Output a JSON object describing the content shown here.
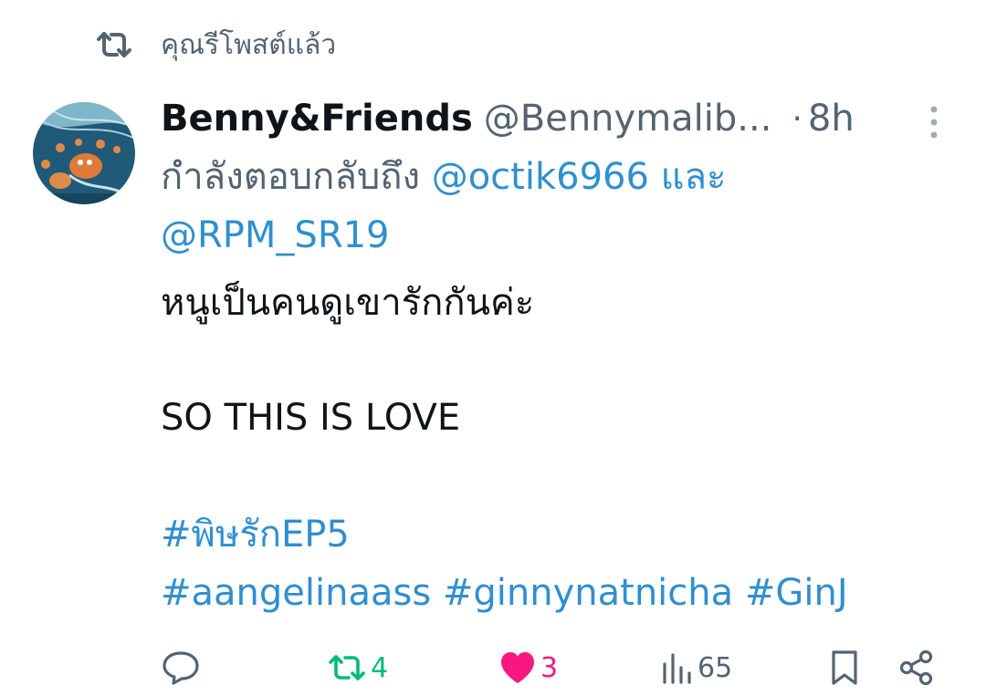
{
  "repost_indicator": {
    "icon": "repost-icon",
    "text": "คุณรีโพสต์แล้ว"
  },
  "tweet": {
    "avatar": "avatar-image",
    "display_name": "Benny&Friends",
    "handle": "@Bennymalib...",
    "separator": "·",
    "time": "8h",
    "reply_prefix": "กำลังตอบกลับถึง",
    "reply_to_1": "@octik6966",
    "reply_joiner": "และ",
    "reply_to_2": "@RPM_SR19",
    "text_line_1": "หนูเป็นคนดูเขารักกันค่ะ",
    "text_line_2": "SO THIS IS LOVE",
    "hashtag_1": "#พิษรักEP5",
    "hashtag_2": "#aangelinaass",
    "hashtag_3": "#ginnynatnicha",
    "hashtag_4": "#GinJ"
  },
  "actions": {
    "reply_icon": "reply-icon",
    "repost_icon": "repost-icon",
    "repost_count": "4",
    "like_icon": "heart-icon",
    "like_count": "3",
    "views_icon": "views-icon",
    "views_count": "65",
    "bookmark_icon": "bookmark-icon",
    "share_icon": "share-icon"
  },
  "colors": {
    "text": "#0f1419",
    "secondary": "#536471",
    "link": "#2f8fd0",
    "repost_active": "#00ba7c",
    "like_active": "#f91880"
  }
}
